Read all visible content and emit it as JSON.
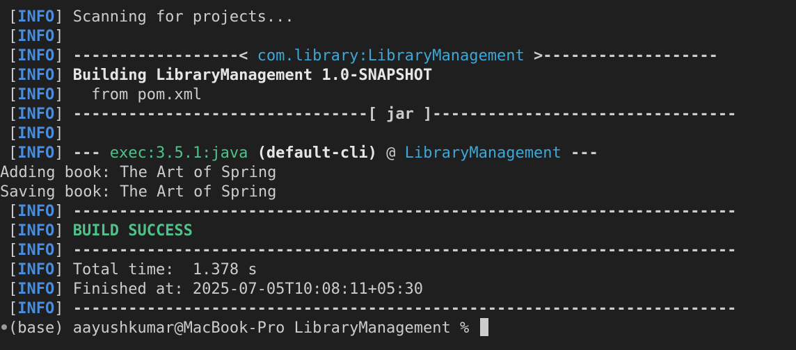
{
  "terminal": {
    "info_tag": "INFO",
    "lines": {
      "l1_text": "Scanning for projects...",
      "l3_dash_left": "------------------< ",
      "l3_artifact": "com.library:LibraryManagement",
      "l3_dash_right": " >-------------------",
      "l4_building": "Building LibraryManagement 1.0-SNAPSHOT",
      "l5_from": "  from pom.xml",
      "l6_jar": "--------------------------------[ jar ]---------------------------------",
      "l8_dash_left": "---",
      "l8_exec": "exec:3.5.1:java",
      "l8_default": "(default-cli)",
      "l8_at": " @ ",
      "l8_project": "LibraryManagement",
      "l8_dash_right": "---",
      "l9": "Adding book: The Art of Spring",
      "l10": "Saving book: The Art of Spring",
      "l11_rule": "------------------------------------------------------------------------",
      "l12_success": "BUILD SUCCESS",
      "l13_rule": "------------------------------------------------------------------------",
      "l14_total": "Total time:  1.378 s",
      "l15_finished": "Finished at: 2025-07-05T10:08:11+05:30",
      "l16_rule": "------------------------------------------------------------------------"
    },
    "prompt": {
      "text": "(base) aayushkumar@MacBook-Pro LibraryManagement % "
    }
  },
  "colors": {
    "background": "#1f1f1f",
    "info_blue": "#4a8ddc",
    "cyan": "#3fa6d6",
    "green": "#4ec28a",
    "text": "#cccccc"
  }
}
